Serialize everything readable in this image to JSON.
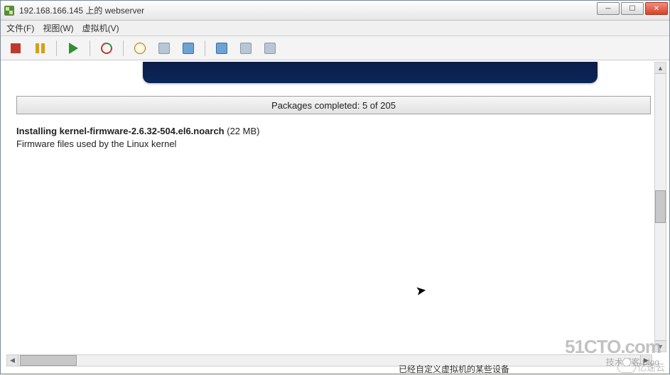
{
  "window": {
    "title": "192.168.166.145 上的 webserver"
  },
  "menu": {
    "file": "文件(F)",
    "view": "视图(W)",
    "vm": "虚拟机(V)"
  },
  "installer": {
    "progress_label": "Packages completed: 5 of 205",
    "installing_prefix": "Installing ",
    "package_name": "kernel-firmware-2.6.32-504.el6.noarch",
    "package_size": " (22 MB)",
    "package_desc": "Firmware files used by the Linux kernel"
  },
  "watermarks": {
    "cto": "51CTO.com",
    "cto_sub": "技术博客   Blog",
    "yisu": "亿速云"
  },
  "footer_hint": "已经自定义虚拟机的某些设备"
}
